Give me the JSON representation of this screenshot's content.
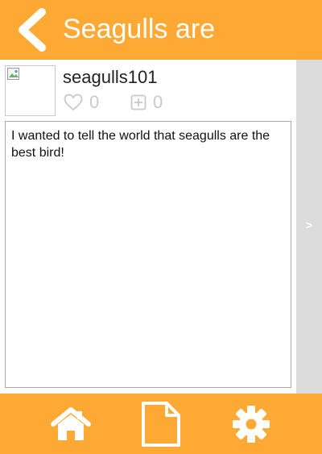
{
  "header": {
    "title": "Seagulls are",
    "back_icon": "chevron-left-icon"
  },
  "post": {
    "username": "seagulls101",
    "likes": "0",
    "adds": "0",
    "body": "I wanted to tell the world that seagulls are the best bird!"
  },
  "side_pager": {
    "label": ">"
  },
  "footer": {
    "home_icon": "home-icon",
    "document_icon": "document-icon",
    "settings_icon": "gear-icon"
  },
  "colors": {
    "accent": "#ffa935",
    "pager": "#dcdcdc",
    "stat_gray": "#c9c9c9"
  }
}
